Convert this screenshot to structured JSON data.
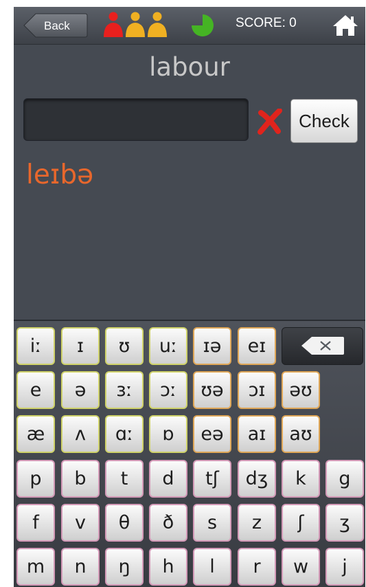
{
  "header": {
    "back_label": "Back",
    "score_text": "SCORE: 0",
    "players": [
      {
        "icon": "person-icon",
        "color": "#e8201e"
      },
      {
        "icon": "person-icon",
        "color": "#f0b022"
      },
      {
        "icon": "person-icon",
        "color": "#f0b022"
      }
    ],
    "progress": {
      "icon": "pie-progress-icon",
      "color": "#45b424",
      "fraction_remaining": 0.75
    },
    "home_icon": "home-icon"
  },
  "quiz": {
    "word": "labour",
    "answer_value": "",
    "wrong_icon": "cross-mark-icon",
    "wrong_color": "#e0241d",
    "check_label": "Check",
    "transcription": "leɪbə",
    "transcription_color": "#e8672c"
  },
  "keyboard": {
    "backspace_icon": "backspace-icon",
    "vowel_border": "#d0d36a",
    "diphthong_border": "#e0a757",
    "consonant_border": "#d49ab8",
    "rows": [
      [
        "iː",
        "ɪ",
        "ʊ",
        "uː",
        "ɪə",
        "eɪ"
      ],
      [
        "e",
        "ə",
        "ɜː",
        "ɔː",
        "ʊə",
        "ɔɪ",
        "əʊ"
      ],
      [
        "æ",
        "ʌ",
        "ɑː",
        "ɒ",
        "eə",
        "aɪ",
        "aʊ"
      ],
      [
        "p",
        "b",
        "t",
        "d",
        "tʃ",
        "dʒ",
        "k",
        "g"
      ],
      [
        "f",
        "v",
        "θ",
        "ð",
        "s",
        "z",
        "ʃ",
        "ʒ"
      ],
      [
        "m",
        "n",
        "ŋ",
        "h",
        "l",
        "r",
        "w",
        "j"
      ]
    ]
  }
}
